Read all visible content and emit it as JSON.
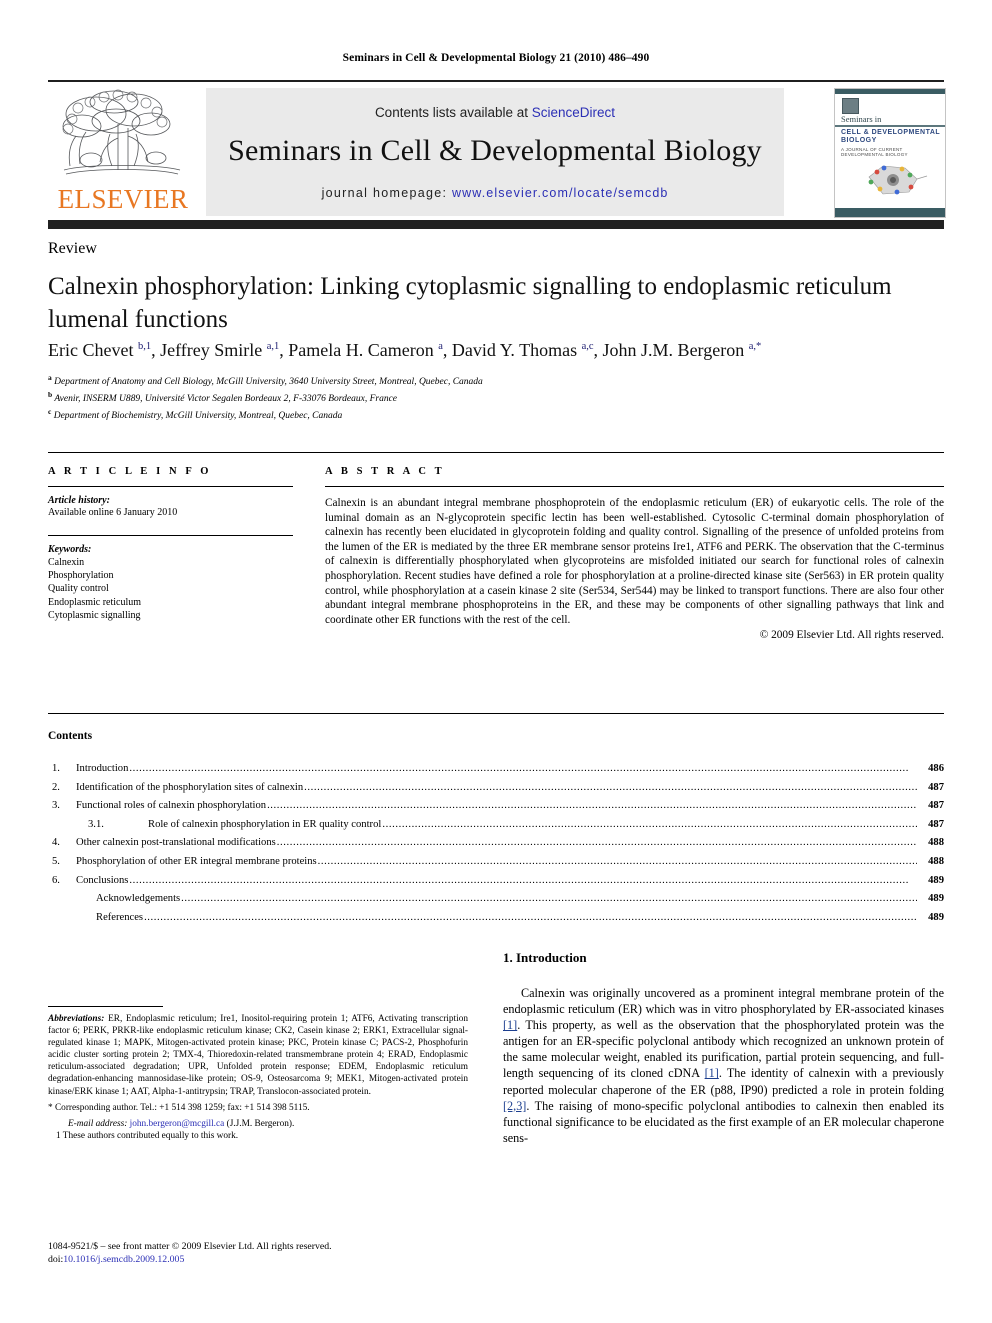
{
  "running_head": "Seminars in Cell & Developmental Biology 21 (2010) 486–490",
  "masthead": {
    "contents_prefix": "Contents lists available at ",
    "sciencedirect": "ScienceDirect",
    "journal_title": "Seminars in Cell & Developmental Biology",
    "homepage_label": "journal homepage:",
    "homepage_url": "www.elsevier.com/locate/semcdb",
    "publisher_wordmark": "ELSEVIER",
    "publisher_color": "#E87722",
    "link_color": "#2b2fb5",
    "cover": {
      "kicker": "Seminars in",
      "line1": "CELL & DEVELOPMENTAL",
      "line2": "BIOLOGY",
      "line3": "A JOURNAL OF CURRENT DEVELOPMENTAL BIOLOGY",
      "header_color": "#3a5c63"
    }
  },
  "article": {
    "doctype": "Review",
    "title": "Calnexin phosphorylation: Linking cytoplasmic signalling to endoplasmic reticulum lumenal functions",
    "authors_html": "Eric Chevet <sup>b,1</sup>, Jeffrey Smirle <sup>a,1</sup>, Pamela H. Cameron <sup>a</sup>, David Y. Thomas <sup>a,c</sup>, John J.M. Bergeron <sup>a,*</sup>",
    "affiliations": [
      {
        "marker": "a",
        "text": "Department of Anatomy and Cell Biology, McGill University, 3640 University Street, Montreal, Quebec, Canada"
      },
      {
        "marker": "b",
        "text": "Avenir, INSERM U889, Université Victor Segalen Bordeaux 2, F-33076 Bordeaux, France"
      },
      {
        "marker": "c",
        "text": "Department of Biochemistry, McGill University, Montreal, Quebec, Canada"
      }
    ]
  },
  "article_info": {
    "heading": "A R T I C L E   I N F O",
    "history_label": "Article history:",
    "history_value": "Available online 6 January 2010",
    "keywords_label": "Keywords:",
    "keywords": [
      "Calnexin",
      "Phosphorylation",
      "Quality control",
      "Endoplasmic reticulum",
      "Cytoplasmic signalling"
    ]
  },
  "abstract": {
    "heading": "A B S T R A C T",
    "text": "Calnexin is an abundant integral membrane phosphoprotein of the endoplasmic reticulum (ER) of eukaryotic cells. The role of the luminal domain as an N-glycoprotein specific lectin has been well-established. Cytosolic C-terminal domain phosphorylation of calnexin has recently been elucidated in glycoprotein folding and quality control. Signalling of the presence of unfolded proteins from the lumen of the ER is mediated by the three ER membrane sensor proteins Ire1, ATF6 and PERK. The observation that the C-terminus of calnexin is differentially phosphorylated when glycoproteins are misfolded initiated our search for functional roles of calnexin phosphorylation. Recent studies have defined a role for phosphorylation at a proline-directed kinase site (Ser563) in ER protein quality control, while phosphorylation at a casein kinase 2 site (Ser534, Ser544) may be linked to transport functions. There are also four other abundant integral membrane phosphoproteins in the ER, and these may be components of other signalling pathways that link and coordinate other ER functions with the rest of the cell.",
    "copyright": "© 2009 Elsevier Ltd. All rights reserved."
  },
  "contents": {
    "heading": "Contents",
    "entries": [
      {
        "num": "1.",
        "label": "Introduction",
        "page": "486",
        "level": 1
      },
      {
        "num": "2.",
        "label": "Identification of the phosphorylation sites of calnexin",
        "page": "487",
        "level": 1
      },
      {
        "num": "3.",
        "label": "Functional roles of calnexin phosphorylation",
        "page": "487",
        "level": 1
      },
      {
        "num": "3.1.",
        "label": "Role of calnexin phosphorylation in ER quality control",
        "page": "487",
        "level": 2
      },
      {
        "num": "4.",
        "label": "Other calnexin post-translational modifications",
        "page": "488",
        "level": 1
      },
      {
        "num": "5.",
        "label": "Phosphorylation of other ER integral membrane proteins",
        "page": "488",
        "level": 1
      },
      {
        "num": "6.",
        "label": "Conclusions",
        "page": "489",
        "level": 1
      },
      {
        "num": "",
        "label": "Acknowledgements",
        "page": "489",
        "level": 3
      },
      {
        "num": "",
        "label": "References",
        "page": "489",
        "level": 3
      }
    ]
  },
  "footnotes": {
    "abbrev_label": "Abbreviations:",
    "abbrev_text": " ER, Endoplasmic reticulum; Ire1, Inositol-requiring protein 1; ATF6, Activating transcription factor 6; PERK, PRKR-like endoplasmic reticulum kinase; CK2, Casein kinase 2; ERK1, Extracellular signal-regulated kinase 1; MAPK, Mitogen-activated protein kinase; PKC, Protein kinase C; PACS-2, Phosphofurin acidic cluster sorting protein 2; TMX-4, Thioredoxin-related transmembrane protein 4; ERAD, Endoplasmic reticulum-associated degradation; UPR, Unfolded protein response; EDEM, Endoplasmic reticulum degradation-enhancing mannosidase-like protein; OS-9, Osteosarcoma 9; MEK1, Mitogen-activated protein kinase/ERK kinase 1; AAT, Alpha-1-antitrypsin; TRAP, Translocon-associated protein.",
    "corresponding": "* Corresponding author. Tel.: +1 514 398 1259; fax: +1 514 398 5115.",
    "email_label": "E-mail address:",
    "email": "john.bergeron@mcgill.ca",
    "email_suffix": "(J.J.M. Bergeron).",
    "equal_contrib": "1 These authors contributed equally to this work."
  },
  "imprint": {
    "issn_line": "1084-9521/$ – see front matter © 2009 Elsevier Ltd. All rights reserved.",
    "doi_label": "doi:",
    "doi_value": "10.1016/j.semcdb.2009.12.005"
  },
  "introduction": {
    "heading": "1.  Introduction",
    "paragraph_parts": [
      "Calnexin was originally uncovered as a prominent integral membrane protein of the endoplasmic reticulum (ER) which was in vitro phosphorylated by ER-associated kinases ",
      "[1]",
      ". This property, as well as the observation that the phosphorylated protein was the antigen for an ER-specific polyclonal antibody which recognized an unknown protein of the same molecular weight, enabled its purification, partial protein sequencing, and full-length sequencing of its cloned cDNA ",
      "[1]",
      ". The identity of calnexin with a previously reported molecular chaperone of the ER (p88, IP90) predicted a role in protein folding ",
      "[2,3]",
      ". The raising of mono-specific polyclonal antibodies to calnexin then enabled its functional significance to be elucidated as the first example of an ER molecular chaperone sens-"
    ]
  }
}
